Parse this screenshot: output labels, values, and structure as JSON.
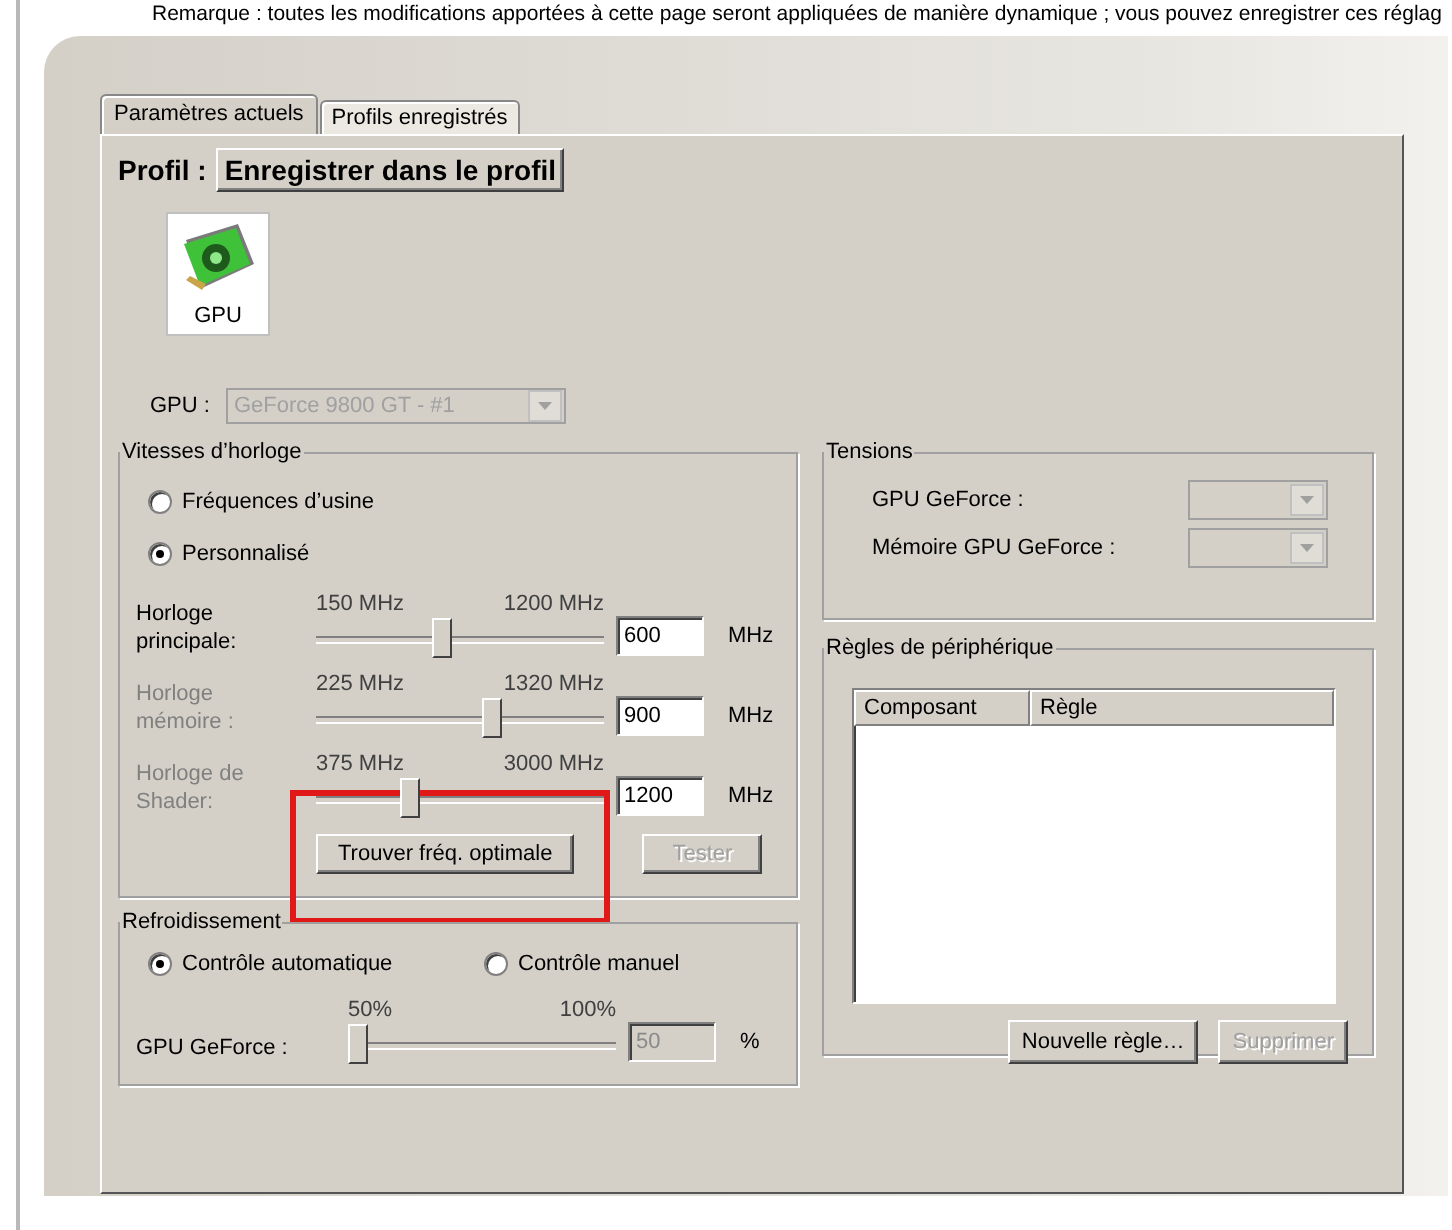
{
  "note": "Remarque : toutes les modifications apportées à cette page seront appliquées de manière dynamique ; vous pouvez enregistrer ces réglag",
  "tabs": [
    {
      "label": "Paramètres actuels",
      "selected": true
    },
    {
      "label": "Profils enregistrés",
      "selected": false
    }
  ],
  "profile": {
    "label": "Profil :",
    "save_button": "Enregistrer dans le profil"
  },
  "device_tile": {
    "label": "GPU",
    "selected": true
  },
  "gpu_select": {
    "label": "GPU :",
    "value": "GeForce 9800 GT - #1",
    "disabled": true
  },
  "clocks": {
    "title": "Vitesses d’horloge",
    "modes": [
      {
        "label": "Fréquences d’usine",
        "selected": false
      },
      {
        "label": "Personnalisé",
        "selected": true
      }
    ],
    "sliders": [
      {
        "label": "Horloge principale:",
        "min": "150 MHz",
        "max": "1200 MHz",
        "level": 0.43,
        "value": "600",
        "unit": "MHz",
        "disabled": false
      },
      {
        "label": "Horloge mémoire :",
        "min": "225 MHz",
        "max": "1320 MHz",
        "level": 0.62,
        "value": "900",
        "unit": "MHz",
        "disabled": true
      },
      {
        "label": "Horloge de Shader:",
        "min": "375 MHz",
        "max": "3000 MHz",
        "level": 0.31,
        "value": "1200",
        "unit": "MHz",
        "disabled": true
      }
    ],
    "buttons": [
      {
        "label": "Trouver fréq. optimale",
        "disabled": false,
        "highlighted": true
      },
      {
        "label": "Tester",
        "disabled": true,
        "highlighted": false
      }
    ]
  },
  "cooling": {
    "title": "Refroidissement",
    "modes": [
      {
        "label": "Contrôle automatique",
        "selected": true
      },
      {
        "label": "Contrôle manuel",
        "selected": false
      }
    ],
    "slider": {
      "label": "GPU GeForce :",
      "min": "50%",
      "max": "100%",
      "level": 0,
      "value": "50",
      "unit": "%",
      "disabled": true
    }
  },
  "voltages": {
    "title": "Tensions",
    "rows": [
      {
        "label": "GPU GeForce :",
        "disabled": true
      },
      {
        "label": "Mémoire GPU GeForce :",
        "disabled": true
      }
    ]
  },
  "rules": {
    "title": "Règles de périphérique",
    "columns": [
      "Composant",
      "Règle"
    ],
    "buttons": [
      {
        "label": "Nouvelle règle…",
        "disabled": false
      },
      {
        "label": "Supprimer",
        "disabled": true
      }
    ]
  }
}
